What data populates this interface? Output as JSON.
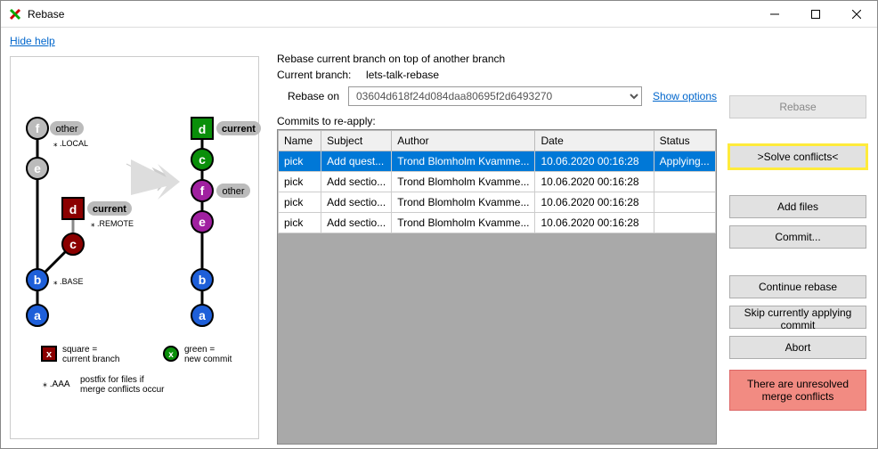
{
  "window": {
    "title": "Rebase"
  },
  "help_link": "Hide help",
  "header": {
    "instruction": "Rebase current branch on top of another branch",
    "current_branch_label": "Current branch:",
    "current_branch": "lets-talk-rebase",
    "rebase_on_label": "Rebase on",
    "rebase_on_value": "03604d618f24d084daa80695f2d6493270",
    "show_options": "Show options",
    "commits_label": "Commits to re-apply:"
  },
  "table": {
    "headers": {
      "name": "Name",
      "subject": "Subject",
      "author": "Author",
      "date": "Date",
      "status": "Status"
    },
    "rows": [
      {
        "name": "pick",
        "subject": "Add quest...",
        "author": "Trond Blomholm Kvamme...",
        "date": "10.06.2020 00:16:28",
        "status": "Applying...",
        "selected": true
      },
      {
        "name": "pick",
        "subject": "Add sectio...",
        "author": "Trond Blomholm Kvamme...",
        "date": "10.06.2020 00:16:28",
        "status": "",
        "selected": false
      },
      {
        "name": "pick",
        "subject": "Add sectio...",
        "author": "Trond Blomholm Kvamme...",
        "date": "10.06.2020 00:16:28",
        "status": "",
        "selected": false
      },
      {
        "name": "pick",
        "subject": "Add sectio...",
        "author": "Trond Blomholm Kvamme...",
        "date": "10.06.2020 00:16:28",
        "status": "",
        "selected": false
      }
    ]
  },
  "buttons": {
    "rebase": "Rebase",
    "solve_conflicts": ">Solve conflicts<",
    "add_files": "Add files",
    "commit": "Commit...",
    "continue_rebase": "Continue rebase",
    "skip": "Skip currently applying commit",
    "abort": "Abort"
  },
  "alert": "There are unresolved merge conflicts",
  "legend": {
    "square_title": "square =",
    "square_sub": "current branch",
    "green_title": "green =",
    "green_sub": "new commit",
    "aaa": ".AAA",
    "aaa_sub1": "postfix for files if",
    "aaa_sub2": "merge conflicts occur"
  },
  "graph_labels": {
    "other": "other",
    "local": "⁎ .LOCAL",
    "current": "current",
    "remote": "⁎ .REMOTE",
    "base": "⁎ .BASE"
  }
}
